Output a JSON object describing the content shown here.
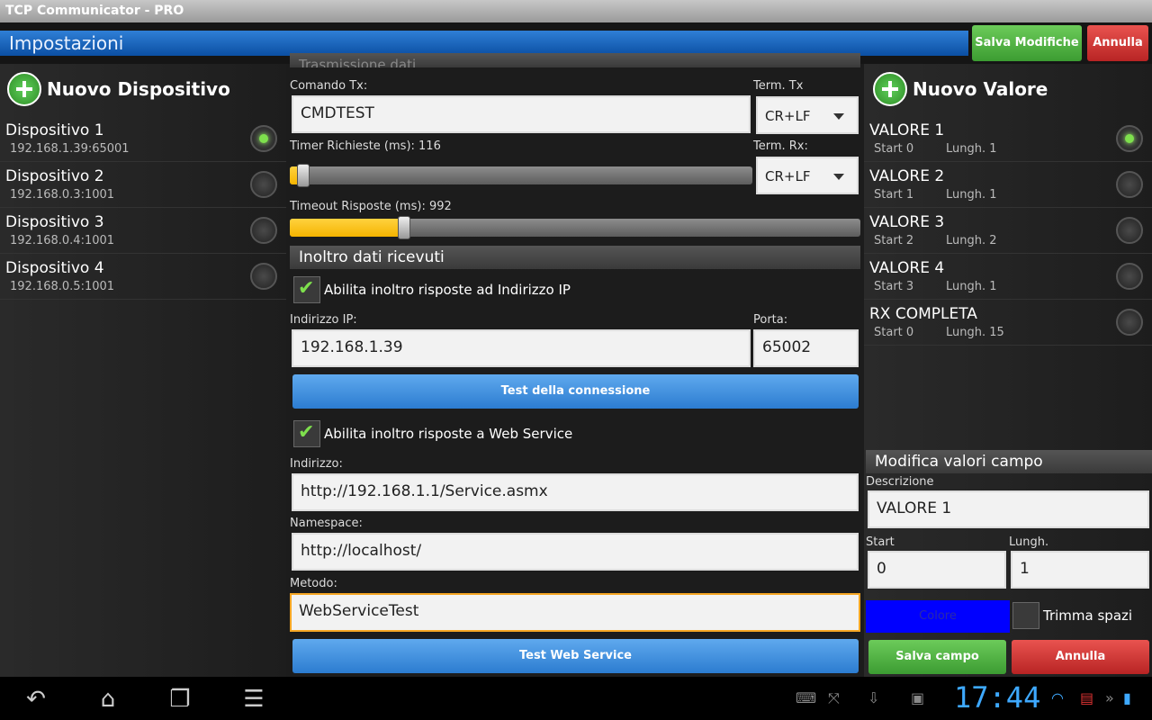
{
  "window": {
    "title": "TCP Communicator - PRO"
  },
  "actionbar": {
    "title": "Impostazioni",
    "save_label": "Salva Modifiche",
    "cancel_label": "Annulla"
  },
  "devices": {
    "add_label": "Nuovo Dispositivo",
    "items": [
      {
        "name": "Dispositivo 1",
        "address": "192.168.1.39:65001",
        "selected": true
      },
      {
        "name": "Dispositivo 2",
        "address": "192.168.0.3:1001",
        "selected": false
      },
      {
        "name": "Dispositivo 3",
        "address": "192.168.0.4:1001",
        "selected": false
      },
      {
        "name": "Dispositivo 4",
        "address": "192.168.0.5:1001",
        "selected": false
      }
    ]
  },
  "tx": {
    "section_title": "Trasmissione dati",
    "command_label": "Comando Tx:",
    "command_value": "CMDTEST",
    "term_tx_label": "Term. Tx",
    "term_tx_value": "CR+LF",
    "timer_label": "Timer Richieste (ms): 116",
    "timer_fraction": 0.03,
    "term_rx_label": "Term. Rx:",
    "term_rx_value": "CR+LF",
    "timeout_label": "Timeout Risposte (ms): 992",
    "timeout_fraction": 0.2
  },
  "forward": {
    "section_title": "Inoltro dati ricevuti",
    "enable_ip_label": "Abilita inoltro risposte ad Indirizzo IP",
    "ip_label": "Indirizzo IP:",
    "ip_value": "192.168.1.39",
    "port_label": "Porta:",
    "port_value": "65002",
    "test_conn_label": "Test della connessione",
    "enable_ws_label": "Abilita inoltro risposte a Web Service",
    "address_label": "Indirizzo:",
    "address_value": "http://192.168.1.1/Service.asmx",
    "namespace_label": "Namespace:",
    "namespace_value": "http://localhost/",
    "method_label": "Metodo:",
    "method_value": "WebServiceTest",
    "test_ws_label": "Test Web Service"
  },
  "values": {
    "add_label": "Nuovo Valore",
    "items": [
      {
        "name": "VALORE 1",
        "start": "Start 0",
        "len": "Lungh. 1",
        "selected": true
      },
      {
        "name": "VALORE 2",
        "start": "Start 1",
        "len": "Lungh. 1",
        "selected": false
      },
      {
        "name": "VALORE 3",
        "start": "Start 2",
        "len": "Lungh. 2",
        "selected": false
      },
      {
        "name": "VALORE 4",
        "start": "Start 3",
        "len": "Lungh. 1",
        "selected": false
      },
      {
        "name": "RX COMPLETA",
        "start": "Start 0",
        "len": "Lungh. 15",
        "selected": false
      }
    ]
  },
  "edit": {
    "section_title": "Modifica valori campo",
    "desc_label": "Descrizione",
    "desc_value": "VALORE 1",
    "start_label": "Start",
    "start_value": "0",
    "len_label": "Lungh.",
    "len_value": "1",
    "color_label": "Colore",
    "color_value": "#0000ff",
    "trim_label": "Trimma spazi",
    "save_label": "Salva campo",
    "cancel_label": "Annulla"
  },
  "status": {
    "time": "17:44"
  }
}
